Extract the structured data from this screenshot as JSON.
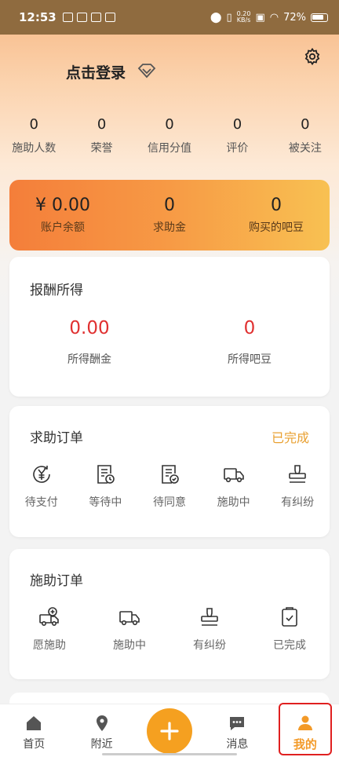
{
  "status_bar": {
    "time": "12:53",
    "net_speed_top": "0.20",
    "net_speed_bottom": "KB/s",
    "battery": "72%"
  },
  "header": {
    "login_text": "点击登录"
  },
  "stats": [
    {
      "value": "0",
      "label": "施助人数"
    },
    {
      "value": "0",
      "label": "荣誉"
    },
    {
      "value": "0",
      "label": "信用分值"
    },
    {
      "value": "0",
      "label": "评价"
    },
    {
      "value": "0",
      "label": "被关注"
    }
  ],
  "wallet": [
    {
      "value": "¥ 0.00",
      "label": "账户余额"
    },
    {
      "value": "0",
      "label": "求助金"
    },
    {
      "value": "0",
      "label": "购买的吧豆"
    }
  ],
  "rewards": {
    "title": "报酬所得",
    "items": [
      {
        "value": "0.00",
        "label": "所得酬金"
      },
      {
        "value": "0",
        "label": "所得吧豆"
      }
    ]
  },
  "help_orders": {
    "title": "求助订单",
    "link": "已完成",
    "items": [
      {
        "label": "待支付",
        "icon": "yuan-refresh-icon"
      },
      {
        "label": "等待中",
        "icon": "doc-clock-icon"
      },
      {
        "label": "待同意",
        "icon": "doc-check-icon"
      },
      {
        "label": "施助中",
        "icon": "truck-icon"
      },
      {
        "label": "有纠纷",
        "icon": "stamp-icon"
      }
    ]
  },
  "give_orders": {
    "title": "施助订单",
    "items": [
      {
        "label": "愿施助",
        "icon": "truck-plus-icon"
      },
      {
        "label": "施助中",
        "icon": "truck-icon"
      },
      {
        "label": "有纠纷",
        "icon": "stamp-icon"
      },
      {
        "label": "已完成",
        "icon": "clipboard-check-icon"
      }
    ]
  },
  "tabbar": [
    {
      "label": "首页",
      "icon": "home-icon"
    },
    {
      "label": "附近",
      "icon": "location-icon"
    },
    {
      "label": "",
      "icon": "plus-icon"
    },
    {
      "label": "消息",
      "icon": "chat-icon"
    },
    {
      "label": "我的",
      "icon": "user-icon",
      "active": true
    }
  ],
  "colors": {
    "accent": "#f5a020",
    "amount_red": "#e03030",
    "link_orange": "#e9a030",
    "highlight": "#e02020"
  }
}
